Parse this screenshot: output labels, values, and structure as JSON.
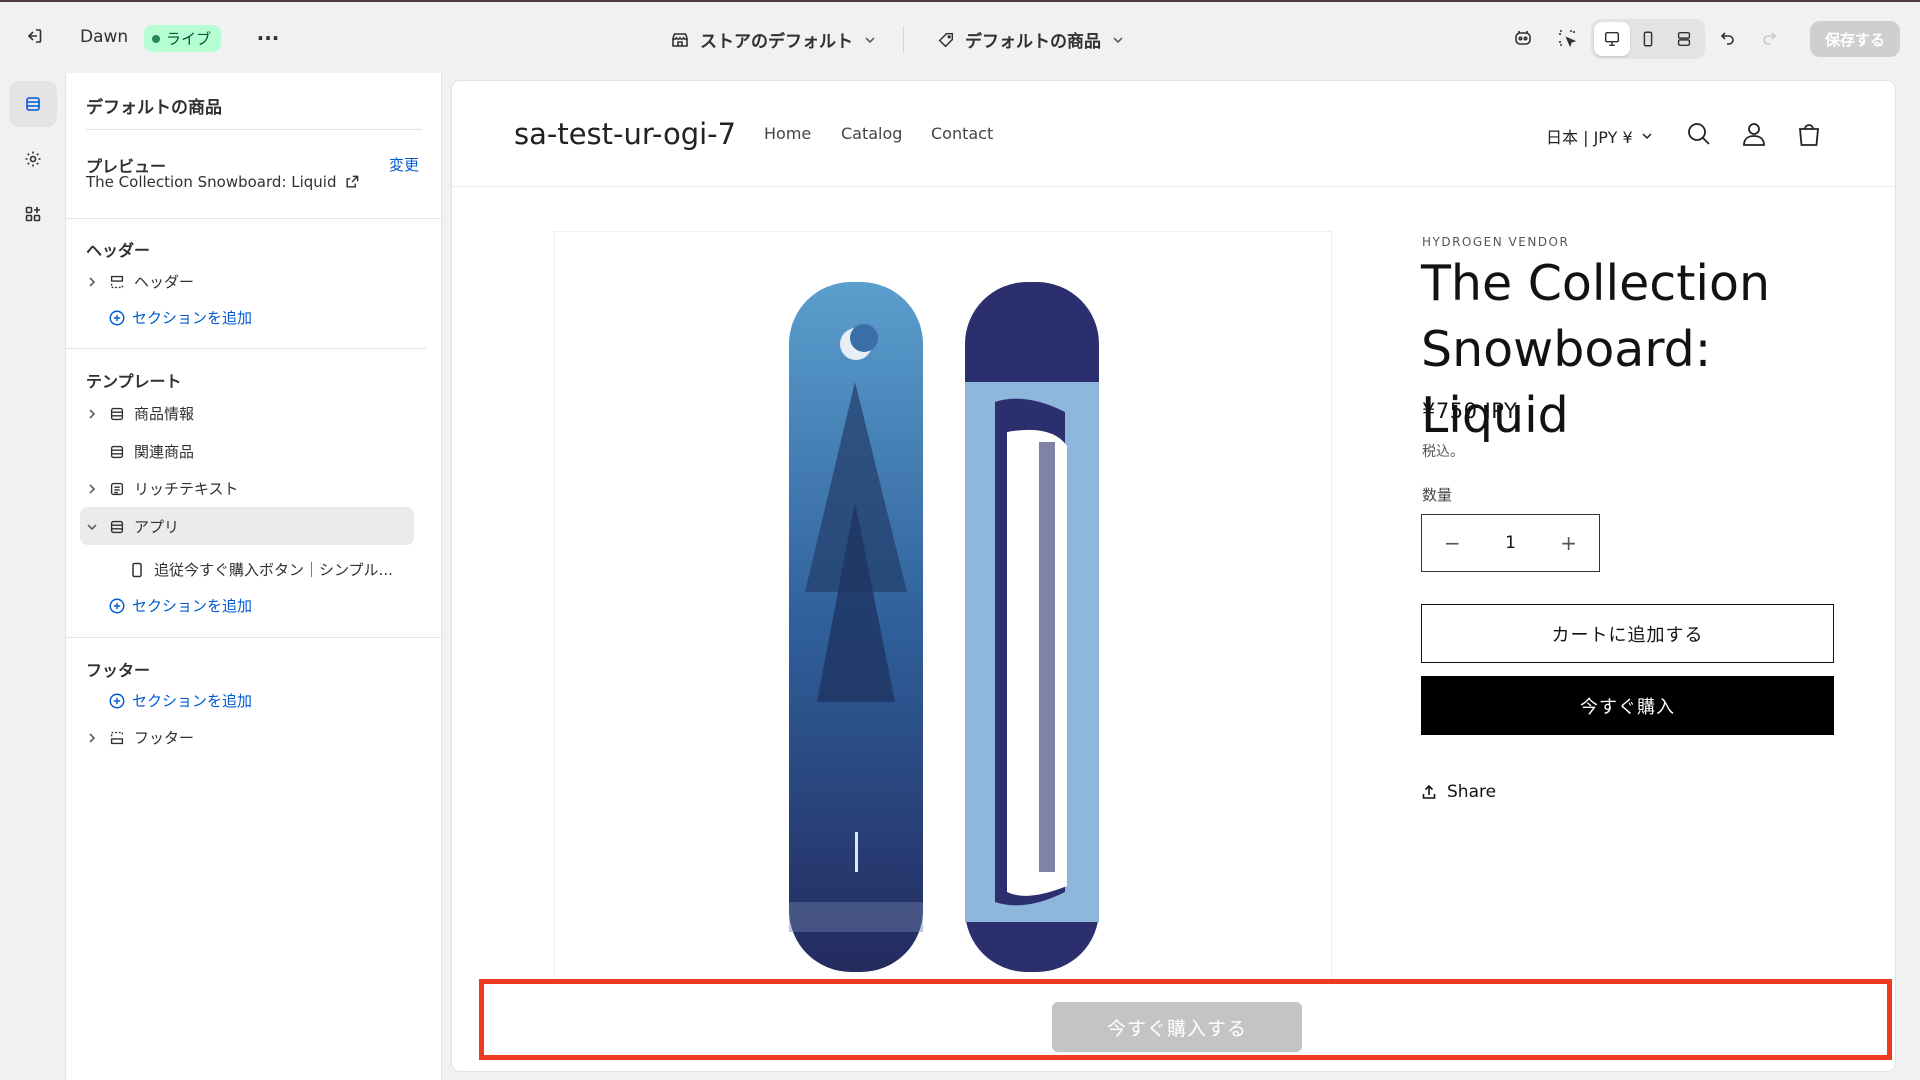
{
  "topbar": {
    "theme_name": "Dawn",
    "live_label": "ライブ",
    "more_label": "···",
    "store_selector": "ストアのデフォルト",
    "template_selector": "デフォルトの商品",
    "save_label": "保存する"
  },
  "panel": {
    "title": "デフォルトの商品",
    "preview_label": "プレビュー",
    "change_label": "変更",
    "preview_product": "The Collection Snowboard: Liquid",
    "header_section": "ヘッダー",
    "header_item": "ヘッダー",
    "add_section": "セクションを追加",
    "template_section": "テンプレート",
    "template_items": [
      "商品情報",
      "関連商品",
      "リッチテキスト",
      "アプリ"
    ],
    "app_block": "追従今すぐ購入ボタン｜シンプル...",
    "footer_section": "フッター",
    "footer_item": "フッター"
  },
  "store": {
    "name": "sa-test-ur-ogi-7",
    "nav": [
      "Home",
      "Catalog",
      "Contact"
    ],
    "currency": "日本 | JPY ¥",
    "vendor": "HYDROGEN VENDOR",
    "product_title": "The Collection Snowboard: Liquid",
    "price": "¥750 JPY",
    "tax_note": "税込。",
    "qty_label": "数量",
    "qty_value": "1",
    "qty_minus": "−",
    "qty_plus": "+",
    "add_to_cart": "カートに追加する",
    "buy_now": "今すぐ購入",
    "share": "Share",
    "sticky_buy": "今すぐ購入する"
  },
  "colors": {
    "accent_link": "#005bd3",
    "live_badge_bg": "#b4fed2",
    "highlight_border": "#ee3b1f",
    "buy_button": "#000000"
  }
}
